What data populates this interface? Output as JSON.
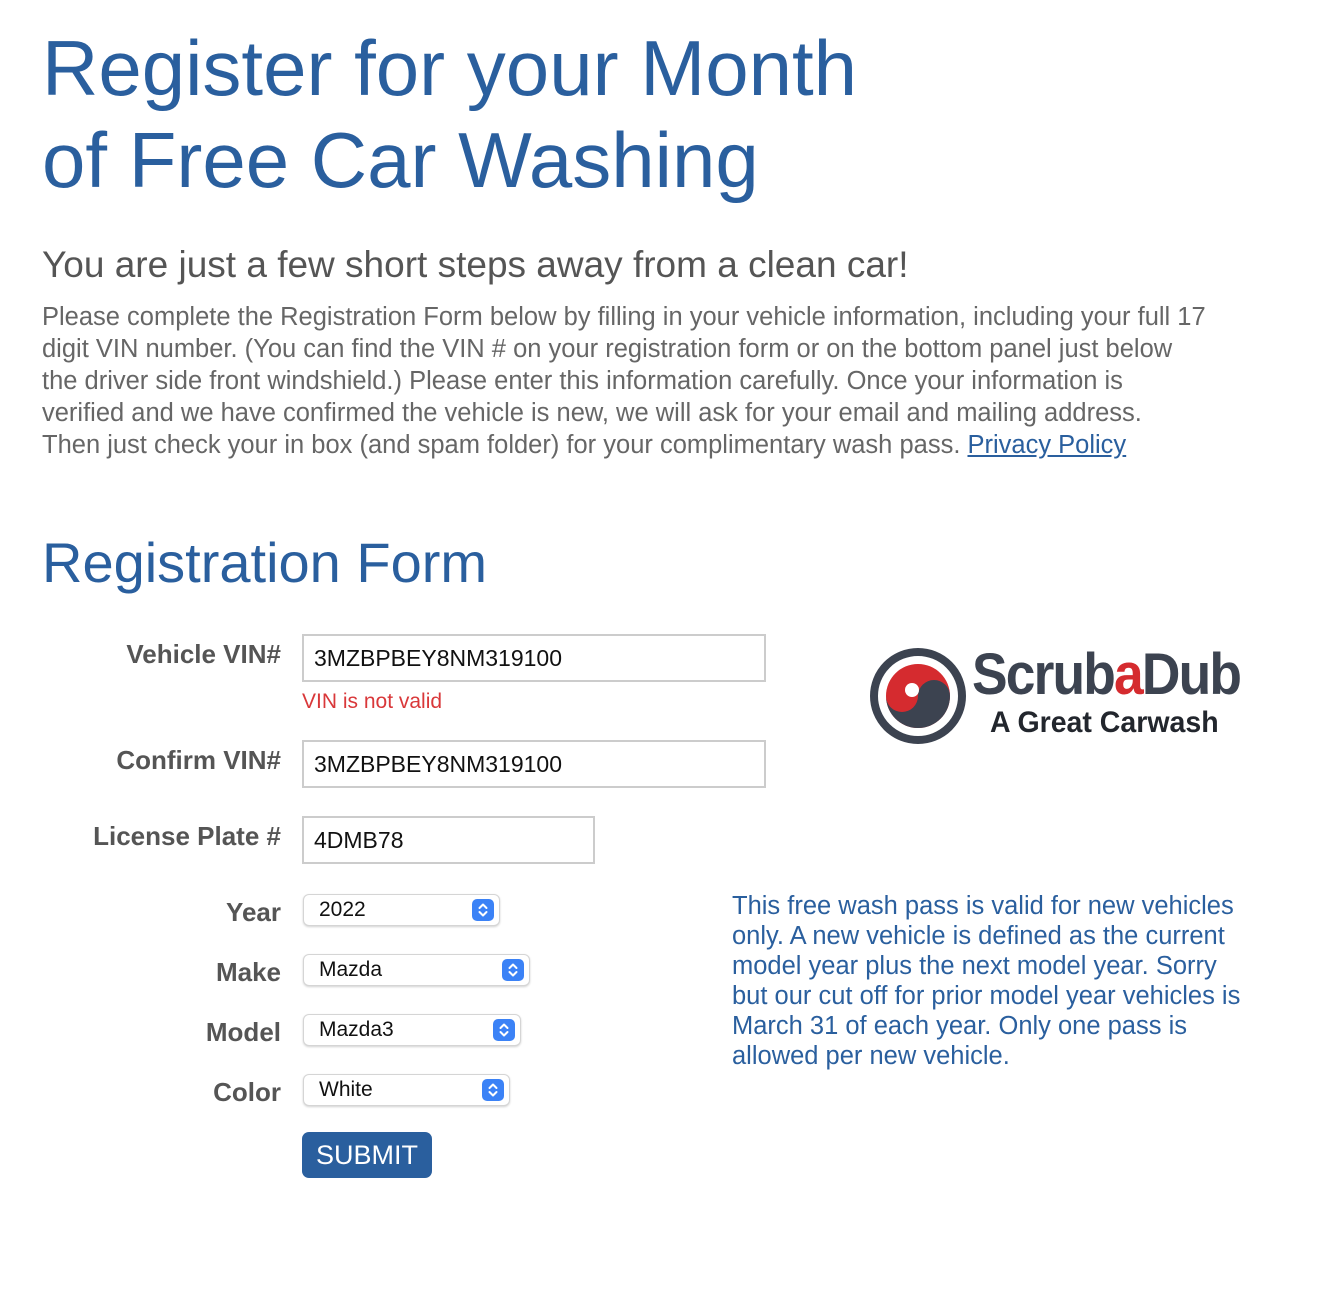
{
  "header": {
    "title_lines": [
      "Register for your Month",
      "of Free Car Washing"
    ],
    "subtitle": "You are just a few short steps away from a clean car!",
    "intro_lines": [
      "Please complete the Registration Form below by filling in your vehicle information, including your full 17",
      "digit VIN number. (You can find the VIN # on your registration form or on the bottom panel just below",
      "the driver side front windshield.) Please enter this information carefully. Once your information is",
      "verified and we have confirmed the vehicle is new, we will ask for your email and mailing address.",
      "Then just check your in box (and spam folder) for your complimentary wash pass. "
    ],
    "privacy_link": "Privacy Policy"
  },
  "form": {
    "heading": "Registration Form",
    "vin": {
      "label": "Vehicle VIN#",
      "value": "3MZBPBEY8NM319100",
      "error": "VIN is not valid"
    },
    "confirm_vin": {
      "label": "Confirm VIN#",
      "value": "3MZBPBEY8NM319100"
    },
    "license_plate": {
      "label": "License Plate #",
      "value": "4DMB78"
    },
    "year": {
      "label": "Year",
      "value": "2022"
    },
    "make": {
      "label": "Make",
      "value": "Mazda"
    },
    "model": {
      "label": "Model",
      "value": "Mazda3"
    },
    "color": {
      "label": "Color",
      "value": "White"
    },
    "submit_label": "SUBMIT"
  },
  "logo": {
    "word_start": "Scrub",
    "word_mid": "a",
    "word_end": "Dub",
    "tagline": "A Great Carwash",
    "colors": {
      "red": "#d52b2f",
      "dark": "#3c4350"
    }
  },
  "note_lines": [
    "This free wash pass is valid for new vehicles",
    "only. A new vehicle is defined as the current",
    "model year plus the next model year. Sorry",
    "but our cut off for prior model year vehicles is",
    "March 31 of each year. Only one pass is",
    "allowed per new vehicle."
  ],
  "theme": {
    "accent": "#2a5f9e",
    "error": "#d9383a",
    "select_chevron": "#3b82f6"
  }
}
